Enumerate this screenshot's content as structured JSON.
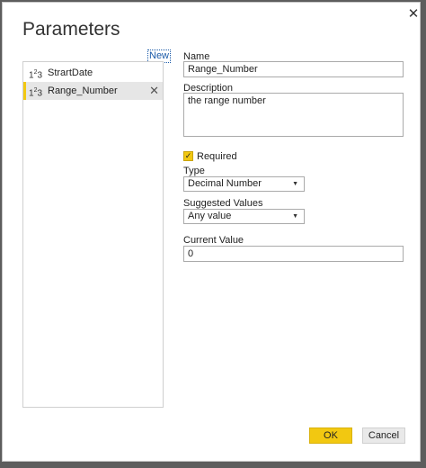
{
  "dialog": {
    "title": "Parameters",
    "close_glyph": "✕",
    "new_label": "New"
  },
  "parameters": [
    {
      "type_icon": "1²3",
      "name": "StrartDate",
      "selected": false
    },
    {
      "type_icon": "1²3",
      "name": "Range_Number",
      "selected": true,
      "remove_glyph": "✕"
    }
  ],
  "form": {
    "name_label": "Name",
    "name_value": "Range_Number",
    "description_label": "Description",
    "description_value": "the range number",
    "required_label": "Required",
    "required_checked": true,
    "type_label": "Type",
    "type_value": "Decimal Number",
    "suggested_label": "Suggested Values",
    "suggested_value": "Any value",
    "current_label": "Current Value",
    "current_value": "0"
  },
  "buttons": {
    "ok": "OK",
    "cancel": "Cancel"
  },
  "colors": {
    "accent": "#f2c811",
    "link": "#1a5aa8"
  },
  "icons": {
    "close": "close-icon",
    "type": "number-type-icon",
    "remove": "remove-icon",
    "checkbox": "checkmark-icon",
    "dropdown": "chevron-down-icon"
  }
}
